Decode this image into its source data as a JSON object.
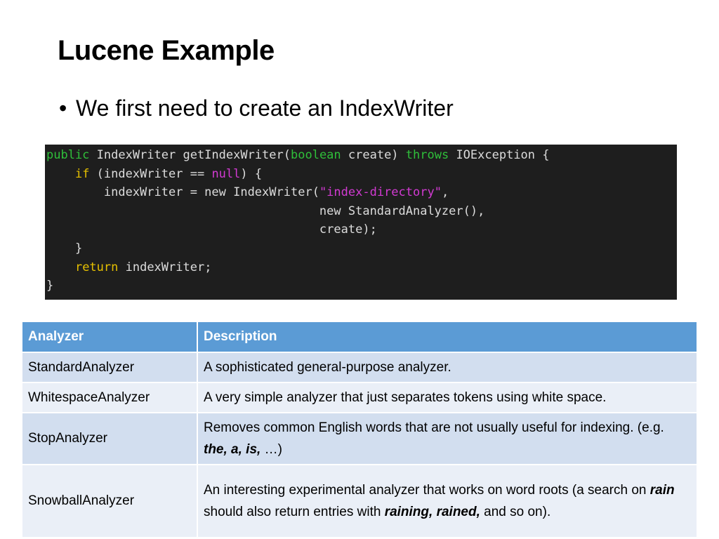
{
  "slide": {
    "title": "Lucene Example",
    "bullet": "We first need to create an IndexWriter"
  },
  "code": {
    "lines": [
      [
        {
          "t": "public",
          "c": "kw"
        },
        {
          "t": " IndexWriter getIndexWriter(",
          "c": "txt"
        },
        {
          "t": "boolean",
          "c": "kw"
        },
        {
          "t": " create) ",
          "c": "txt"
        },
        {
          "t": "throws",
          "c": "kw"
        },
        {
          "t": " IOException {",
          "c": "txt"
        }
      ],
      [
        {
          "t": "    ",
          "c": "txt"
        },
        {
          "t": "if",
          "c": "ctl"
        },
        {
          "t": " (indexWriter == ",
          "c": "txt"
        },
        {
          "t": "null",
          "c": "nul"
        },
        {
          "t": ") {",
          "c": "txt"
        }
      ],
      [
        {
          "t": "        indexWriter = new IndexWriter(",
          "c": "txt"
        },
        {
          "t": "\"index-directory\"",
          "c": "str"
        },
        {
          "t": ",",
          "c": "txt"
        }
      ],
      [
        {
          "t": "                                      new StandardAnalyzer(),",
          "c": "txt"
        }
      ],
      [
        {
          "t": "                                      create);",
          "c": "txt"
        }
      ],
      [
        {
          "t": "    }",
          "c": "txt"
        }
      ],
      [
        {
          "t": "    ",
          "c": "txt"
        },
        {
          "t": "return",
          "c": "ctl"
        },
        {
          "t": " indexWriter;",
          "c": "txt"
        }
      ],
      [
        {
          "t": "}",
          "c": "txt"
        }
      ]
    ]
  },
  "table": {
    "headers": [
      "Analyzer",
      "Description"
    ],
    "rows": [
      {
        "name": "StandardAnalyzer",
        "desc": [
          {
            "t": "A sophisticated general-purpose analyzer."
          }
        ]
      },
      {
        "name": "WhitespaceAnalyzer",
        "desc": [
          {
            "t": "A very simple analyzer that just separates tokens using white space."
          }
        ]
      },
      {
        "name": "StopAnalyzer",
        "desc": [
          {
            "t": "Removes common English words that are not usually useful for indexing. (e.g. "
          },
          {
            "t": "the, a, is,",
            "bi": true
          },
          {
            "t": " …)"
          }
        ]
      },
      {
        "name": "SnowballAnalyzer",
        "desc": [
          {
            "t": "An interesting experimental analyzer that works on word roots (a search on "
          },
          {
            "t": "rain",
            "bi": true
          },
          {
            "t": " should also return entries with "
          },
          {
            "t": "raining, rained,",
            "bi": true
          },
          {
            "t": " and so on)."
          }
        ]
      }
    ]
  }
}
